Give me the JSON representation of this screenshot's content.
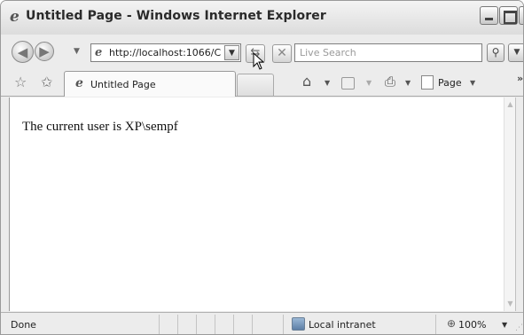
{
  "window": {
    "title": "Untitled Page - Windows Internet Explorer"
  },
  "nav": {
    "address_url": "http://localhost:1066/C",
    "search_placeholder": "Live Search"
  },
  "tabs": [
    {
      "label": "Untitled Page"
    }
  ],
  "command_bar": {
    "page_label": "Page"
  },
  "page": {
    "text": "The current user is XP\\sempf"
  },
  "status": {
    "text": "Done",
    "zone": "Local intranet",
    "zoom": "100%"
  },
  "icons": [
    "ie-logo-icon",
    "back-icon",
    "forward-icon",
    "refresh-icon",
    "stop-icon",
    "search-icon",
    "favorites-star-icon",
    "add-favorites-icon",
    "home-icon",
    "feeds-icon",
    "print-icon",
    "page-icon",
    "zone-icon",
    "zoom-icon"
  ]
}
